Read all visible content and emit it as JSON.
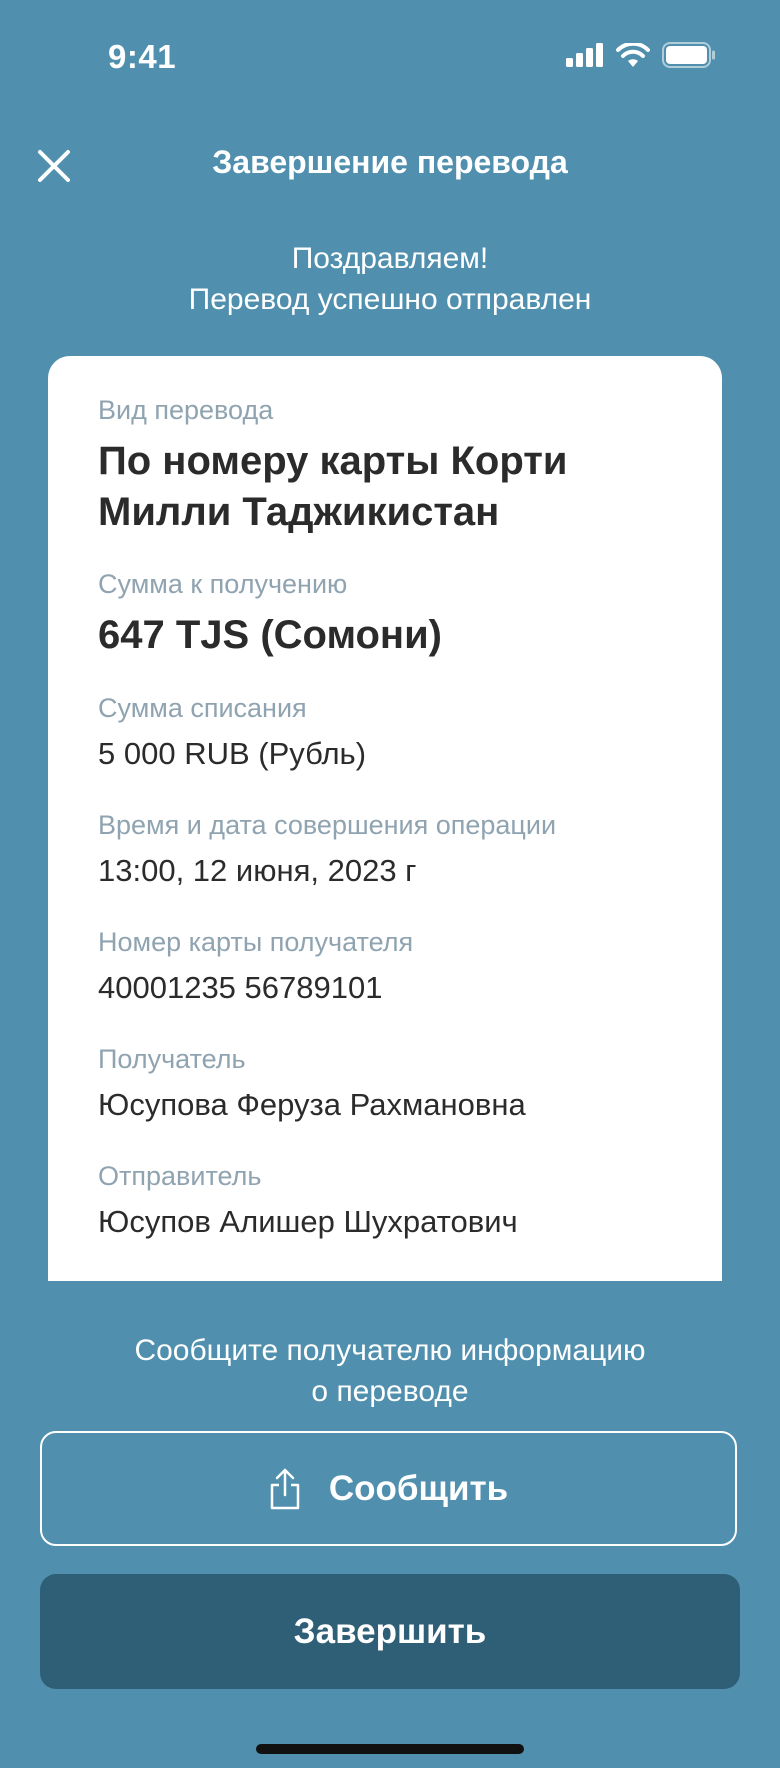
{
  "status_bar": {
    "time": "9:41",
    "icons": [
      "signal-icon",
      "wifi-icon",
      "battery-icon"
    ]
  },
  "header": {
    "title": "Завершение перевода",
    "close_icon": "close-icon"
  },
  "congrats": {
    "line1": "Поздравляем!",
    "line2": "Перевод успешно отправлен"
  },
  "receipt": {
    "transfer_type": {
      "label": "Вид перевода",
      "value": "По номеру карты Корти Милли Таджикистан"
    },
    "amount_received": {
      "label": "Сумма к получению",
      "value": "647 TJS (Сомони)"
    },
    "amount_debited": {
      "label": "Сумма списания",
      "value": "5 000 RUB (Рубль)"
    },
    "datetime": {
      "label": "Время и дата совершения операции",
      "value": "13:00, 12 июня, 2023 г"
    },
    "card_number": {
      "label": "Номер карты получателя",
      "value": "40001235 56789101"
    },
    "recipient": {
      "label": "Получатель",
      "value": "Юсупова Феруза Рахмановна"
    },
    "sender": {
      "label": "Отправитель",
      "value": "Юсупов Алишер Шухратович"
    }
  },
  "notify": {
    "line1": "Сообщите получателю информацию",
    "line2": "о переводе"
  },
  "buttons": {
    "share_label": "Сообщить",
    "share_icon": "share-icon",
    "finish_label": "Завершить"
  },
  "colors": {
    "background": "#5090AE",
    "finish_button": "#2F5F77",
    "label_gray": "#8FA3B0",
    "text_dark": "#2B2B2B"
  }
}
